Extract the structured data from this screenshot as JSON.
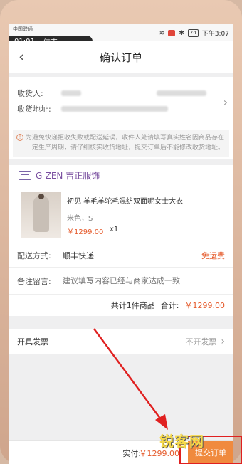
{
  "status": {
    "carrier": "中国联通",
    "time_left": "01:01",
    "call_end": "结束",
    "battery": "74",
    "time_right": "下午3:07"
  },
  "nav": {
    "title": "确认订单"
  },
  "address": {
    "recipient_label": "收货人:",
    "address_label": "收货地址:",
    "notice": "为避免快递拒收失败或配送延误，收件人处请填写真实姓名因商品存在一定生产周期，请仔细核实收货地址，提交订单后不能修改收货地址。"
  },
  "shop": {
    "name": "G-ZEN 吉正服饰"
  },
  "item": {
    "title": "初见 羊毛羊驼毛混纺双面呢女士大衣",
    "spec": "米色，S",
    "price": "￥1299.00",
    "qty": "x1"
  },
  "shipping": {
    "label": "配送方式:",
    "value": "顺丰快递",
    "fee": "免运费"
  },
  "memo": {
    "label": "备注留言:",
    "placeholder": "建议填写内容已经与商家达成一致"
  },
  "summary": {
    "count": "共计1件商品",
    "total_label": "合计:",
    "total": "￥1299.00"
  },
  "invoice": {
    "label": "开具发票",
    "value": "不开发票"
  },
  "footer": {
    "paid_label": "实付:",
    "paid_value": "￥1299.00",
    "submit": "提交订单"
  },
  "watermark": "锐客网",
  "colors": {
    "accent": "#e55a2b",
    "submit": "#f08a3e",
    "brand": "#7a4fa0",
    "highlight": "#e02020"
  },
  "icons": [
    "back-icon",
    "chevron-right-icon",
    "info-icon",
    "shop-icon",
    "battery-icon",
    "wifi-icon",
    "bluetooth-icon"
  ]
}
